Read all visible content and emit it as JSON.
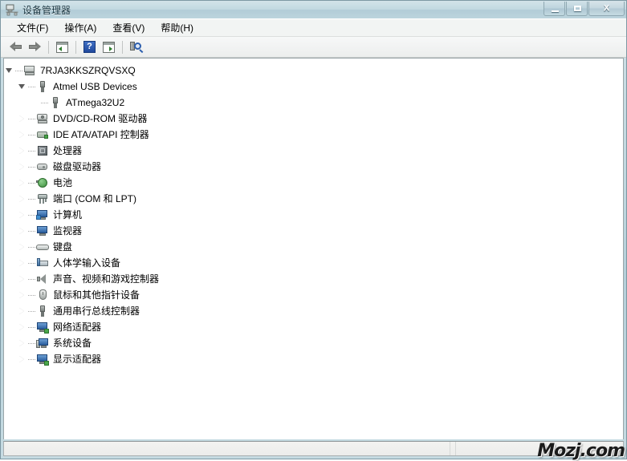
{
  "window": {
    "title": "设备管理器",
    "title_icon": "device-manager-icon",
    "controls": {
      "minimize": "minimize-button",
      "maximize": "maximize-button",
      "close_label": "X"
    }
  },
  "menu": {
    "items": [
      {
        "label": "文件(F)",
        "name": "menu-file"
      },
      {
        "label": "操作(A)",
        "name": "menu-action"
      },
      {
        "label": "查看(V)",
        "name": "menu-view"
      },
      {
        "label": "帮助(H)",
        "name": "menu-help"
      }
    ]
  },
  "toolbar": {
    "buttons": [
      {
        "name": "back-button",
        "icon": "arrow-left-icon"
      },
      {
        "name": "forward-button",
        "icon": "arrow-right-icon"
      },
      {
        "name": "show-hide-console-tree-button",
        "icon": "panel-left-icon"
      },
      {
        "name": "help-button",
        "icon": "help-icon",
        "glyph": "?"
      },
      {
        "name": "properties-button",
        "icon": "panel-right-icon"
      },
      {
        "name": "scan-hardware-changes-button",
        "icon": "scan-hardware-icon"
      }
    ]
  },
  "tree": {
    "nodes": [
      {
        "label": "7RJA3KKSZRQVSXQ",
        "icon": "computer-icon",
        "state": "expanded",
        "level": 0,
        "name": "tree-node-computer-root"
      },
      {
        "label": "Atmel USB Devices",
        "icon": "usb-icon",
        "state": "expanded",
        "level": 1,
        "name": "tree-node-atmel-usb-devices"
      },
      {
        "label": "ATmega32U2",
        "icon": "usb-icon",
        "state": "leaf",
        "level": 2,
        "name": "tree-node-atmega32u2"
      },
      {
        "label": "DVD/CD-ROM 驱动器",
        "icon": "dvd-drive-icon",
        "state": "collapsed",
        "level": 1,
        "name": "tree-node-dvd-cdrom"
      },
      {
        "label": "IDE ATA/ATAPI 控制器",
        "icon": "ide-controller-icon",
        "state": "collapsed",
        "level": 1,
        "name": "tree-node-ide-ata-atapi"
      },
      {
        "label": "处理器",
        "icon": "processor-icon",
        "state": "collapsed",
        "level": 1,
        "name": "tree-node-processors"
      },
      {
        "label": "磁盘驱动器",
        "icon": "disk-drive-icon",
        "state": "collapsed",
        "level": 1,
        "name": "tree-node-disk-drives"
      },
      {
        "label": "电池",
        "icon": "battery-icon",
        "state": "collapsed",
        "level": 1,
        "name": "tree-node-batteries"
      },
      {
        "label": "端口 (COM 和 LPT)",
        "icon": "ports-icon",
        "state": "collapsed",
        "level": 1,
        "name": "tree-node-ports"
      },
      {
        "label": "计算机",
        "icon": "computer-blue-icon",
        "state": "collapsed",
        "level": 1,
        "name": "tree-node-computer"
      },
      {
        "label": "监视器",
        "icon": "monitor-icon",
        "state": "collapsed",
        "level": 1,
        "name": "tree-node-monitors"
      },
      {
        "label": "键盘",
        "icon": "keyboard-icon",
        "state": "collapsed",
        "level": 1,
        "name": "tree-node-keyboards"
      },
      {
        "label": "人体学输入设备",
        "icon": "hid-icon",
        "state": "collapsed",
        "level": 1,
        "name": "tree-node-hid"
      },
      {
        "label": "声音、视频和游戏控制器",
        "icon": "sound-icon",
        "state": "collapsed",
        "level": 1,
        "name": "tree-node-sound-video-game"
      },
      {
        "label": "鼠标和其他指针设备",
        "icon": "mouse-icon",
        "state": "collapsed",
        "level": 1,
        "name": "tree-node-mice"
      },
      {
        "label": "通用串行总线控制器",
        "icon": "usb-icon",
        "state": "collapsed",
        "level": 1,
        "name": "tree-node-usb-controllers"
      },
      {
        "label": "网络适配器",
        "icon": "network-adapter-icon",
        "state": "collapsed",
        "level": 1,
        "name": "tree-node-network-adapters"
      },
      {
        "label": "系统设备",
        "icon": "system-device-icon",
        "state": "collapsed",
        "level": 1,
        "name": "tree-node-system-devices"
      },
      {
        "label": "显示适配器",
        "icon": "display-adapter-icon",
        "state": "collapsed",
        "level": 1,
        "name": "tree-node-display-adapters"
      }
    ]
  },
  "statusbar": {
    "text": ""
  },
  "watermark": {
    "text": "Mozj.com"
  },
  "colors": {
    "title_bar": "#b4cfd9",
    "tree_background": "#ffffff",
    "accent_blue": "#2a5e9e",
    "accent_green": "#49a349"
  }
}
